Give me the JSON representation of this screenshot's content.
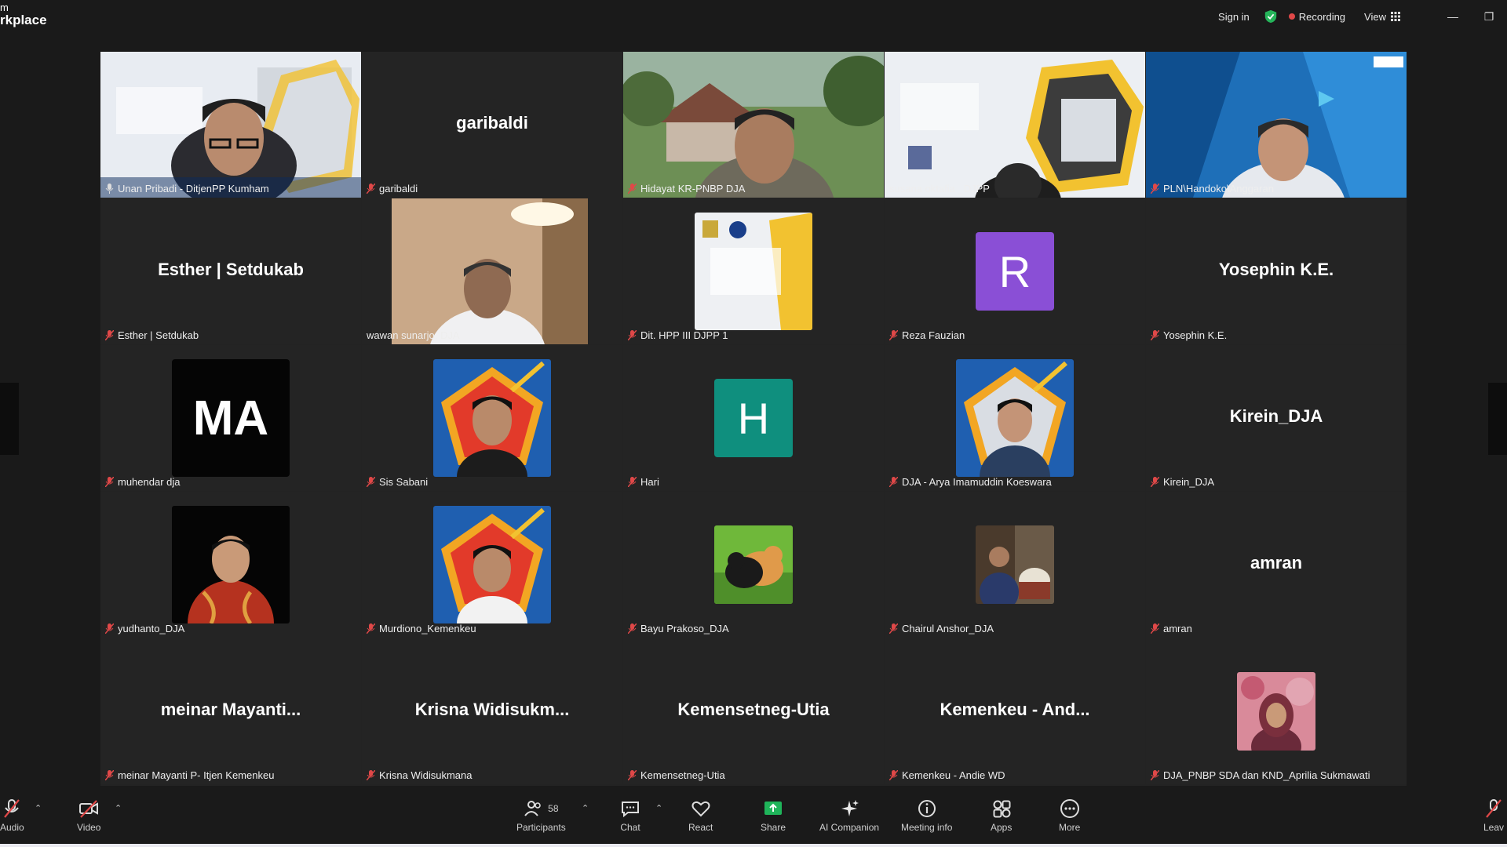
{
  "app": {
    "brand_line1": "m",
    "brand_line2": "rkplace"
  },
  "topbar": {
    "sign_in": "Sign in",
    "recording": "Recording",
    "view": "View"
  },
  "tiles": [
    {
      "label": "Unan Pribadi - DitjenPP Kumham",
      "big": ""
    },
    {
      "label": "garibaldi",
      "big": "garibaldi"
    },
    {
      "label": "Hidayat KR-PNBP DJA",
      "big": ""
    },
    {
      "label": "susana oktafia _DJPP",
      "big": ""
    },
    {
      "label": "PLN\\Handoko\\Anggaran",
      "big": ""
    },
    {
      "label": "Esther | Setdukab",
      "big": "Esther | Setdukab"
    },
    {
      "label": "wawan sunarjo. DJA",
      "big": ""
    },
    {
      "label": "Dit. HPP III DJPP 1",
      "big": ""
    },
    {
      "label": "Reza Fauzian",
      "big": ""
    },
    {
      "label": "Yosephin K.E.",
      "big": "Yosephin K.E."
    },
    {
      "label": "muhendar dja",
      "big": ""
    },
    {
      "label": "Sis Sabani",
      "big": ""
    },
    {
      "label": "Hari",
      "big": ""
    },
    {
      "label": "DJA - Arya Imamuddin Koeswara",
      "big": ""
    },
    {
      "label": "Kirein_DJA",
      "big": "Kirein_DJA"
    },
    {
      "label": "yudhanto_DJA",
      "big": ""
    },
    {
      "label": "Murdiono_Kemenkeu",
      "big": ""
    },
    {
      "label": "Bayu Prakoso_DJA",
      "big": ""
    },
    {
      "label": "Chairul Anshor_DJA",
      "big": ""
    },
    {
      "label": "amran",
      "big": "amran"
    },
    {
      "label": "meinar Mayanti P- Itjen Kemenkeu",
      "big": "meinar  Mayanti..."
    },
    {
      "label": "Krisna Widisukmana",
      "big": "Krisna  Widisukm..."
    },
    {
      "label": "Kemensetneg-Utia",
      "big": "Kemensetneg-Utia"
    },
    {
      "label": "Kemenkeu - Andie WD",
      "big": "Kemenkeu - And..."
    },
    {
      "label": "DJA_PNBP SDA dan KND_Aprilia Sukmawati",
      "big": ""
    }
  ],
  "avatars": {
    "reza": "R",
    "muhendar": "MA",
    "hari": "H"
  },
  "toolbar": {
    "audio": "Audio",
    "video": "Video",
    "participants": "Participants",
    "participants_count": "58",
    "chat": "Chat",
    "react": "React",
    "share": "Share",
    "ai": "AI Companion",
    "info": "Meeting info",
    "apps": "Apps",
    "more": "More",
    "leave": "Leav"
  },
  "colors": {
    "active_border": "#4ccb6e",
    "reza_bg": "#8a4fd6",
    "hari_bg": "#0f8f7e",
    "share_green": "#1fb45a",
    "mute_red": "#e04848"
  }
}
